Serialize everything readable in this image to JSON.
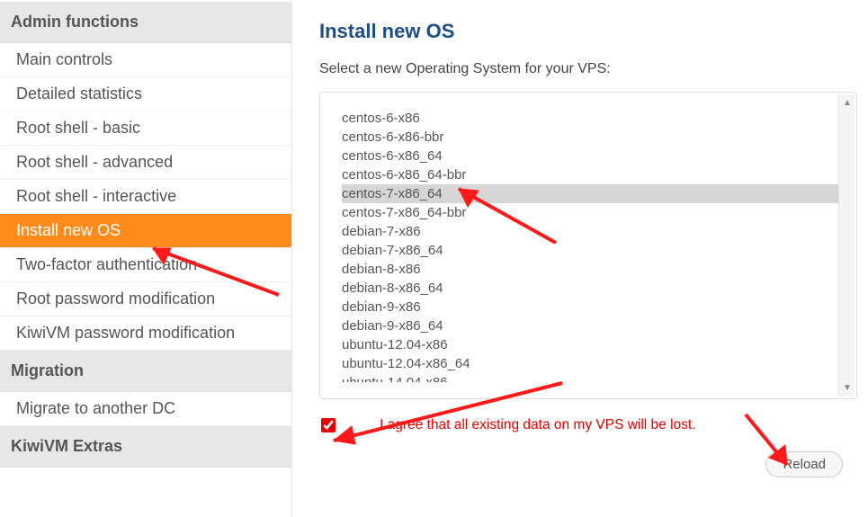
{
  "sidebar": {
    "headings": {
      "admin": "Admin functions",
      "migration": "Migration",
      "extras": "KiwiVM Extras"
    },
    "items": [
      {
        "label": "Main controls"
      },
      {
        "label": "Detailed statistics"
      },
      {
        "label": "Root shell - basic"
      },
      {
        "label": "Root shell - advanced"
      },
      {
        "label": "Root shell - interactive"
      },
      {
        "label": "Install new OS",
        "active": true
      },
      {
        "label": "Two-factor authentication"
      },
      {
        "label": "Root password modification"
      },
      {
        "label": "KiwiVM password modification"
      }
    ],
    "migration_items": [
      {
        "label": "Migrate to another DC"
      }
    ]
  },
  "main": {
    "title": "Install new OS",
    "subtitle": "Select a new Operating System for your VPS:",
    "os_options": [
      "centos-6-x86",
      "centos-6-x86-bbr",
      "centos-6-x86_64",
      "centos-6-x86_64-bbr",
      "centos-7-x86_64",
      "centos-7-x86_64-bbr",
      "debian-7-x86",
      "debian-7-x86_64",
      "debian-8-x86",
      "debian-8-x86_64",
      "debian-9-x86",
      "debian-9-x86_64",
      "ubuntu-12.04-x86",
      "ubuntu-12.04-x86_64",
      "ubuntu-14.04-x86"
    ],
    "selected_index": 4,
    "agree_checked": true,
    "agree_label": "I agree that all existing data on my VPS will be lost.",
    "reload_label": "Reload"
  }
}
